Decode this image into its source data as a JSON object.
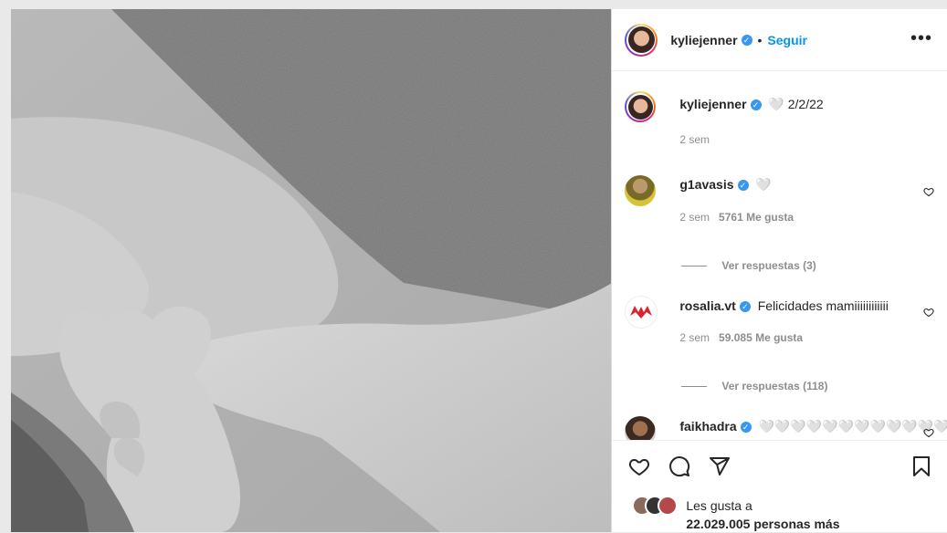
{
  "post": {
    "image_alt": "Black and white photo of an adult hand holding a baby's hand"
  },
  "header": {
    "username": "kyliejenner",
    "separator": "•",
    "follow_label": "Seguir",
    "more_label": "•••"
  },
  "caption": {
    "username": "kyliejenner",
    "text": "🤍 2/2/22",
    "time": "2 sem"
  },
  "comments": [
    {
      "username": "g1avasis",
      "text": "🤍",
      "time": "2 sem",
      "likes": "5761 Me gusta",
      "replies": "Ver respuestas (3)"
    },
    {
      "username": "rosalia.vt",
      "text": "Felicidades mamiiiiiiiiiiii",
      "time": "2 sem",
      "likes": "59.085 Me gusta",
      "replies": "Ver respuestas (118)"
    },
    {
      "username": "faikhadra",
      "text": "🤍🤍🤍🤍🤍🤍🤍🤍🤍🤍🤍🤍"
    }
  ],
  "likes": {
    "prefix": "Les gusta a",
    "count_text": "22.029.005 personas más"
  },
  "colors": {
    "accent": "#0095f6",
    "verified": "#3897f0",
    "muted": "#8e8e8e",
    "text": "#262626"
  }
}
